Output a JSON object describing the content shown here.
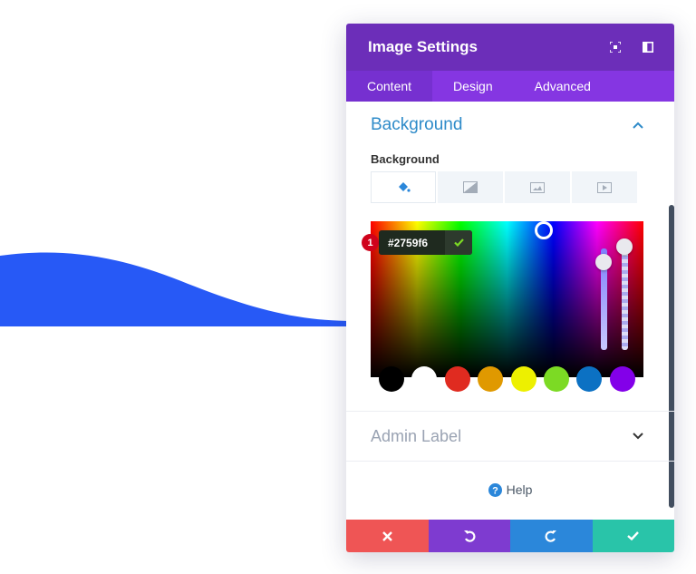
{
  "header": {
    "title": "Image Settings",
    "icons": [
      "focus-icon",
      "sidebar-toggle-icon"
    ]
  },
  "tabs": [
    {
      "label": "Content",
      "active": true
    },
    {
      "label": "Design",
      "active": false
    },
    {
      "label": "Advanced",
      "active": false
    }
  ],
  "background_section": {
    "title": "Background",
    "field_label": "Background",
    "type_icons": [
      "paint-bucket-icon",
      "gradient-icon",
      "image-icon",
      "video-icon"
    ]
  },
  "color_picker": {
    "hex_value": "#2759f6",
    "badge_number": "1",
    "swatches": [
      "#000000",
      "#ffffff",
      "#e02b20",
      "#e09900",
      "#edf000",
      "#7cda24",
      "#0c71c3",
      "#8300e9"
    ]
  },
  "admin_label": {
    "title": "Admin Label"
  },
  "help": {
    "label": "Help"
  },
  "footer": {
    "colors": {
      "cancel": "#ef5555",
      "undo": "#7e3bd0",
      "redo": "#2b87da",
      "save": "#29c4a9"
    }
  },
  "colors": {
    "header": "#6c2eb9",
    "tabs": "#8536e2",
    "accent": "#2e8bc9",
    "wave": "#2759f6"
  }
}
